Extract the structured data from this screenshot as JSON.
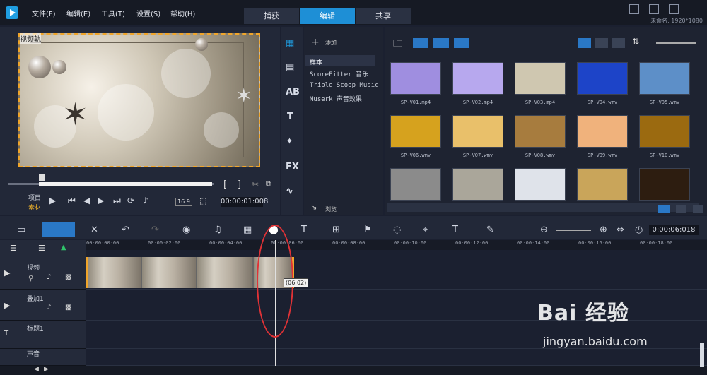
{
  "menu": {
    "file": "文件(F)",
    "edit": "编辑(E)",
    "tools": "工具(T)",
    "settings": "设置(S)",
    "help": "帮助(H)"
  },
  "tabs": {
    "capture": "捕获",
    "edit": "编辑",
    "share": "共享"
  },
  "project_info": "未命名, 1920*1080",
  "player": {
    "track_label": "视频轨",
    "project_label": "项目",
    "clip_label": "素材",
    "aspect": "16:9",
    "timecode": "00:00:01:008"
  },
  "library": {
    "add_label": "添加",
    "categories": [
      "样本",
      "ScoreFitter 音乐",
      "Triple Scoop Music",
      "Muserk 声音效果"
    ],
    "browse_label": "浏览",
    "thumbnails": [
      {
        "label": "SP-V01.mp4",
        "color": "#9f8ee0"
      },
      {
        "label": "SP-V02.mp4",
        "color": "#b7a8ee"
      },
      {
        "label": "SP-V03.mp4",
        "color": "#cfc7b0"
      },
      {
        "label": "SP-V04.wmv",
        "color": "#1d44c8"
      },
      {
        "label": "SP-V05.wmv",
        "color": "#5d8fc8"
      },
      {
        "label": "SP-V06.wmv",
        "color": "#d6a21e"
      },
      {
        "label": "SP-V07.wmv",
        "color": "#e9c06a"
      },
      {
        "label": "SP-V08.wmv",
        "color": "#a77c3e"
      },
      {
        "label": "SP-V09.wmv",
        "color": "#f0b27c"
      },
      {
        "label": "SP-V10.wmv",
        "color": "#9b6a10"
      },
      {
        "label": "",
        "color": "#8b8b8b"
      },
      {
        "label": "",
        "color": "#aaa69a"
      },
      {
        "label": "",
        "color": "#dfe3ea"
      },
      {
        "label": "",
        "color": "#c9a55a"
      },
      {
        "label": "",
        "color": "#2d1d10"
      }
    ]
  },
  "toolbar_timecode": "0:00:06:018",
  "ruler": [
    "00:00:00:00",
    "00:00:02:00",
    "00:00:04:00",
    "00:00:06:00",
    "00:00:08:00",
    "00:00:10:00",
    "00:00:12:00",
    "00:00:14:00",
    "00:00:16:00",
    "00:00:18:00"
  ],
  "tracks": [
    "视频",
    "叠加1",
    "标题1",
    "声音"
  ],
  "tooltip": "(06:02)",
  "watermark": {
    "brand": "Bai 经验",
    "url": "jingyan.baidu.com"
  }
}
